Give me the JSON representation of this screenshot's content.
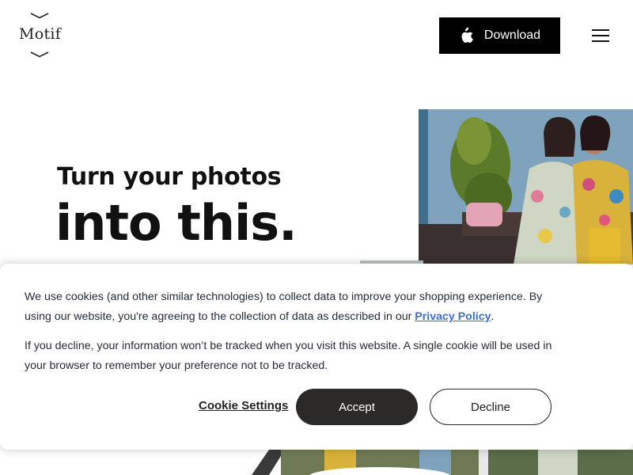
{
  "header": {
    "logo_text": "Motif",
    "download_label": "Download",
    "download_icon": "apple-icon",
    "menu_icon": "hamburger-menu-icon"
  },
  "hero": {
    "line1": "Turn your photos",
    "line2": "into this."
  },
  "cookie_banner": {
    "paragraph1_before_link": "We use cookies (and other similar technologies) to collect data to improve your shopping experience. By using our website, you're agreeing to the collection of data as described in our ",
    "privacy_link_text": "Privacy Policy",
    "paragraph1_after_link": ".",
    "paragraph2": "If you decline, your information won’t be tracked when you visit this website. A single cookie will be used in your browser to remember your preference not to be tracked.",
    "settings_label": "Cookie Settings",
    "accept_label": "Accept",
    "decline_label": "Decline"
  },
  "colors": {
    "accent_dark": "#2b2a28",
    "link": "#3b6fd8",
    "text": "#262a3b"
  }
}
